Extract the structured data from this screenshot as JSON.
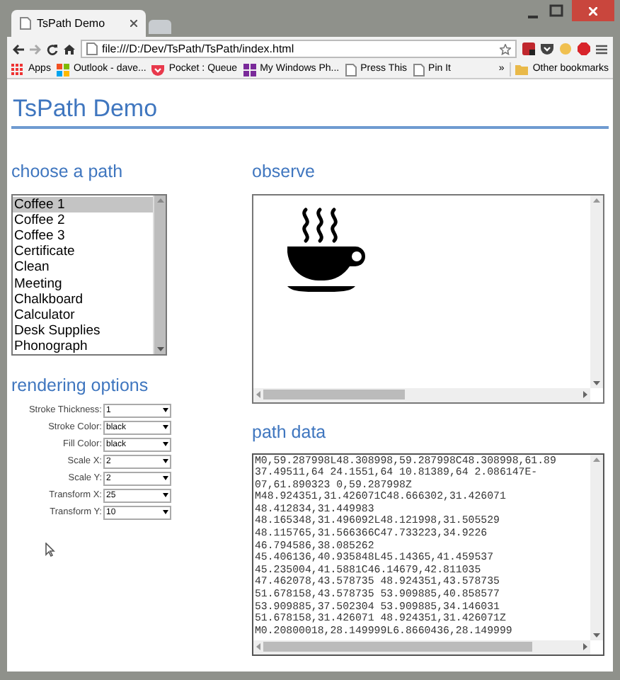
{
  "browser": {
    "tabs": [
      {
        "title": "TsPath Demo",
        "selected": true
      }
    ],
    "address": "file:///D:/Dev/TsPath/TsPath/index.html",
    "bookmarks": [
      {
        "label": "Apps",
        "kind": "apps"
      },
      {
        "label": "Outlook - dave...",
        "kind": "windows"
      },
      {
        "label": "Pocket : Queue",
        "kind": "pocket"
      },
      {
        "label": "My Windows Ph...",
        "kind": "tile"
      },
      {
        "label": "Press This",
        "kind": "page"
      },
      {
        "label": "Pin It",
        "kind": "page"
      }
    ],
    "overflow": "»",
    "other_bookmarks": "Other bookmarks"
  },
  "page": {
    "title": "TsPath Demo",
    "choose": {
      "heading": "choose a path",
      "items": [
        {
          "label": "Coffee 1",
          "selected": true
        },
        {
          "label": "Coffee 2",
          "selected": false
        },
        {
          "label": "Coffee 3",
          "selected": false
        },
        {
          "label": "Certificate",
          "selected": false
        },
        {
          "label": "Clean",
          "selected": false
        },
        {
          "label": "Meeting",
          "selected": false
        },
        {
          "label": "Chalkboard",
          "selected": false
        },
        {
          "label": "Calculator",
          "selected": false
        },
        {
          "label": "Desk Supplies",
          "selected": false
        },
        {
          "label": "Phonograph",
          "selected": false
        }
      ]
    },
    "rendering": {
      "heading": "rendering options",
      "options": [
        {
          "label": "Stroke Thickness:",
          "value": "1"
        },
        {
          "label": "Stroke Color:",
          "value": "black"
        },
        {
          "label": "Fill Color:",
          "value": "black"
        },
        {
          "label": "Scale X:",
          "value": "2"
        },
        {
          "label": "Scale Y:",
          "value": "2"
        },
        {
          "label": "Transform X:",
          "value": "25"
        },
        {
          "label": "Transform Y:",
          "value": "10"
        }
      ]
    },
    "observe": {
      "heading": "observe"
    },
    "path_data": {
      "heading": "path data",
      "lines": [
        "M0,59.287998L48.308998,59.287998C48.308998,61.89",
        "37.49511,64 24.1551,64 10.81389,64 2.086147E-",
        "07,61.890323 0,59.287998Z",
        "M48.924351,31.426071C48.666302,31.426071",
        "48.412834,31.449983",
        "48.165348,31.496092L48.121998,31.505529",
        "48.115765,31.566366C47.733223,34.9226",
        "46.794586,38.085262",
        "45.406136,40.935848L45.14365,41.459537",
        "45.235004,41.5881C46.14679,42.811035",
        "47.462078,43.578735 48.924351,43.578735",
        "51.678158,43.578735 53.909885,40.858577",
        "53.909885,37.502304 53.909885,34.146031",
        "51.678158,31.426071 48.924351,31.426071Z",
        "M0.20800018,28.149999L6.8660436,28.149999"
      ]
    }
  }
}
